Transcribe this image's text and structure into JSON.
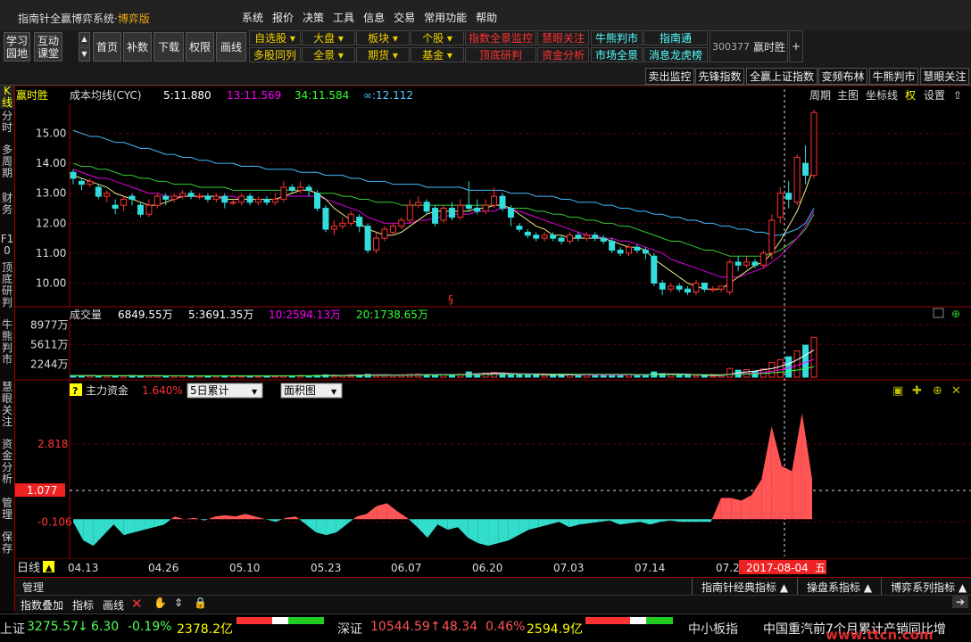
{
  "window": {
    "title": "指南针全赢博弈系统",
    "title_suffix": "博弈版",
    "sep": "·"
  },
  "menu": [
    "系统",
    "报价",
    "决策",
    "工具",
    "信息",
    "交易",
    "常用功能",
    "帮助"
  ],
  "toolbar": {
    "big": [
      "学习园地",
      "互动课堂",
      "首页",
      "补数",
      "下载",
      "权限",
      "画线"
    ],
    "arrows": [
      "▲",
      "▼"
    ],
    "row1": [
      {
        "t": "自选股 ▾",
        "c": "yel"
      },
      {
        "t": "大盘 ▾",
        "c": "yel"
      },
      {
        "t": "板块 ▾",
        "c": "yel"
      },
      {
        "t": "个股 ▾",
        "c": "yel"
      },
      {
        "t": "指数全景监控",
        "c": "red"
      },
      {
        "t": "慧眼关注",
        "c": "red"
      },
      {
        "t": "牛熊判市",
        "c": "cyan"
      },
      {
        "t": "指南通",
        "c": "cyan"
      }
    ],
    "row2": [
      {
        "t": "多股同列",
        "c": "yel"
      },
      {
        "t": "全景 ▾",
        "c": "yel"
      },
      {
        "t": "期货 ▾",
        "c": "yel"
      },
      {
        "t": "基金 ▾",
        "c": "yel"
      },
      {
        "t": "顶底研判",
        "c": "red"
      },
      {
        "t": "资金分析",
        "c": "red"
      },
      {
        "t": "市场全景",
        "c": "cyan"
      },
      {
        "t": "消息龙虎榜",
        "c": "cyan"
      }
    ],
    "stock_code": "300377",
    "stock_name": "赢时胜",
    "plus": "+",
    "tabs": [
      "卖出监控",
      "先锋指数",
      "全赢上证指数",
      "变频布林",
      "牛熊判市",
      "慧眼关注"
    ]
  },
  "leftbar": [
    "K线",
    "分时",
    "多周期",
    "财务",
    "F10",
    "顶底研判",
    "牛熊判市",
    "慧眼关注",
    "资金分析",
    "管理",
    "保存"
  ],
  "chart_header": {
    "name": "赢时胜",
    "indicator": "成本均线(CYC)",
    "ma5": "5:11.880",
    "ma13": "13:11.569",
    "ma34": "34:11.584",
    "mainf": "∞:12.112",
    "right_tools": [
      "周期",
      "主图",
      "坐标线",
      "权",
      "设置",
      "⇧"
    ]
  },
  "chart_data": [
    {
      "type": "candlestick",
      "title": "",
      "yticks": [
        "15.00",
        "14.00",
        "13.00",
        "12.00",
        "11.00",
        "10.00"
      ],
      "ylim": [
        9.3,
        16.0
      ],
      "candles": [
        [
          13.7,
          13.5,
          13.8,
          13.3
        ],
        [
          13.4,
          13.3,
          13.5,
          13.1
        ],
        [
          13.3,
          13.4,
          13.5,
          13.2
        ],
        [
          13.2,
          12.9,
          13.3,
          12.8
        ],
        [
          12.9,
          13.0,
          13.1,
          12.7
        ],
        [
          12.6,
          12.5,
          12.8,
          12.3
        ],
        [
          12.6,
          12.8,
          12.9,
          12.4
        ],
        [
          12.9,
          12.8,
          13.0,
          12.6
        ],
        [
          12.6,
          12.3,
          12.7,
          12.2
        ],
        [
          12.3,
          12.6,
          12.8,
          12.2
        ],
        [
          12.6,
          12.9,
          13.0,
          12.5
        ],
        [
          12.9,
          12.8,
          13.0,
          12.6
        ],
        [
          12.8,
          12.9,
          13.0,
          12.7
        ],
        [
          12.9,
          13.0,
          13.1,
          12.8
        ],
        [
          13.0,
          12.9,
          13.1,
          12.8
        ],
        [
          12.9,
          12.9,
          13.0,
          12.8
        ],
        [
          12.9,
          12.8,
          13.0,
          12.7
        ],
        [
          12.8,
          12.9,
          13.0,
          12.7
        ],
        [
          12.9,
          12.7,
          13.0,
          12.5
        ],
        [
          12.7,
          12.7,
          12.8,
          12.6
        ],
        [
          12.7,
          12.9,
          13.0,
          12.6
        ],
        [
          12.9,
          12.7,
          13.0,
          12.6
        ],
        [
          12.7,
          12.8,
          12.9,
          12.6
        ],
        [
          12.8,
          12.7,
          12.9,
          12.6
        ],
        [
          12.7,
          12.8,
          13.0,
          12.6
        ],
        [
          12.8,
          13.2,
          13.4,
          12.7
        ],
        [
          13.2,
          13.1,
          13.3,
          13.0
        ],
        [
          13.1,
          13.2,
          13.4,
          13.0
        ],
        [
          13.2,
          13.1,
          13.3,
          12.9
        ],
        [
          13.0,
          12.5,
          13.1,
          12.4
        ],
        [
          12.5,
          11.8,
          12.6,
          11.7
        ],
        [
          11.8,
          11.9,
          12.1,
          11.6
        ],
        [
          11.9,
          12.0,
          12.2,
          11.8
        ],
        [
          12.0,
          12.3,
          12.4,
          11.9
        ],
        [
          12.2,
          11.9,
          12.3,
          11.7
        ],
        [
          11.9,
          11.1,
          12.0,
          11.0
        ],
        [
          11.1,
          11.5,
          11.7,
          11.0
        ],
        [
          11.5,
          11.8,
          11.9,
          11.4
        ],
        [
          11.7,
          11.9,
          12.0,
          11.6
        ],
        [
          11.9,
          12.1,
          12.2,
          11.8
        ],
        [
          12.1,
          12.6,
          12.8,
          12.0
        ],
        [
          12.6,
          12.7,
          12.9,
          12.5
        ],
        [
          12.7,
          12.4,
          12.8,
          12.3
        ],
        [
          12.5,
          12.0,
          12.6,
          11.9
        ],
        [
          12.1,
          12.5,
          12.6,
          12.0
        ],
        [
          12.5,
          12.2,
          12.7,
          12.1
        ],
        [
          12.2,
          12.6,
          12.8,
          12.1
        ],
        [
          12.6,
          12.5,
          13.4,
          12.4
        ],
        [
          12.5,
          12.4,
          12.8,
          12.3
        ],
        [
          12.4,
          12.6,
          12.8,
          12.3
        ],
        [
          12.6,
          12.9,
          13.2,
          12.5
        ],
        [
          12.9,
          12.5,
          13.0,
          12.4
        ],
        [
          12.5,
          12.2,
          12.6,
          11.9
        ],
        [
          11.9,
          11.8,
          12.0,
          11.7
        ],
        [
          11.7,
          11.6,
          11.8,
          11.5
        ],
        [
          11.6,
          11.5,
          11.7,
          11.4
        ],
        [
          11.5,
          11.6,
          11.7,
          11.4
        ],
        [
          11.6,
          11.5,
          11.7,
          11.4
        ],
        [
          11.5,
          11.4,
          11.6,
          11.3
        ],
        [
          11.4,
          11.6,
          11.7,
          11.3
        ],
        [
          11.6,
          11.5,
          11.7,
          11.4
        ],
        [
          11.5,
          11.6,
          11.7,
          11.4
        ],
        [
          11.6,
          11.5,
          11.7,
          11.4
        ],
        [
          11.5,
          11.4,
          11.6,
          11.3
        ],
        [
          11.4,
          11.1,
          11.5,
          11.0
        ],
        [
          11.1,
          11.0,
          11.2,
          10.9
        ],
        [
          11.0,
          11.2,
          11.3,
          10.9
        ],
        [
          11.2,
          11.1,
          11.3,
          11.0
        ],
        [
          11.1,
          11.0,
          11.2,
          10.8
        ],
        [
          10.9,
          10.0,
          11.0,
          9.9
        ],
        [
          10.0,
          9.8,
          10.1,
          9.6
        ],
        [
          9.8,
          9.9,
          10.0,
          9.7
        ],
        [
          9.9,
          9.8,
          10.0,
          9.7
        ],
        [
          9.8,
          9.7,
          9.9,
          9.6
        ],
        [
          9.7,
          10.0,
          10.1,
          9.6
        ],
        [
          10.0,
          9.8,
          10.0,
          9.7
        ],
        [
          9.8,
          9.8,
          9.9,
          9.7
        ],
        [
          9.8,
          9.9,
          9.9,
          9.7
        ],
        [
          9.7,
          10.7,
          10.8,
          9.6
        ],
        [
          10.7,
          10.6,
          10.9,
          10.4
        ],
        [
          10.6,
          10.7,
          10.9,
          10.5
        ],
        [
          10.7,
          10.6,
          10.8,
          10.5
        ],
        [
          10.6,
          11.0,
          11.1,
          10.5
        ],
        [
          11.0,
          12.1,
          12.3,
          10.8
        ],
        [
          12.2,
          13.0,
          13.2,
          12.0
        ],
        [
          13.0,
          12.8,
          13.4,
          12.5
        ],
        [
          12.7,
          14.2,
          14.3,
          12.6
        ],
        [
          14.0,
          13.6,
          14.6,
          13.3
        ],
        [
          13.6,
          15.7,
          15.8,
          13.5
        ]
      ],
      "ma5": [
        13.6,
        13.5,
        13.4,
        13.3,
        13.2,
        13.0,
        12.9,
        12.8,
        12.7,
        12.6,
        12.6,
        12.7,
        12.8,
        12.9,
        12.9,
        12.9,
        12.9,
        12.9,
        12.8,
        12.8,
        12.8,
        12.8,
        12.8,
        12.8,
        12.8,
        12.9,
        13.0,
        13.1,
        13.1,
        13.0,
        12.8,
        12.5,
        12.3,
        12.1,
        12.0,
        11.8,
        11.7,
        11.6,
        11.6,
        11.7,
        11.9,
        12.1,
        12.3,
        12.4,
        12.4,
        12.4,
        12.4,
        12.4,
        12.5,
        12.5,
        12.6,
        12.6,
        12.5,
        12.3,
        12.1,
        11.9,
        11.8,
        11.6,
        11.6,
        11.5,
        11.5,
        11.5,
        11.5,
        11.5,
        11.4,
        11.3,
        11.2,
        11.2,
        11.1,
        10.8,
        10.6,
        10.4,
        10.2,
        10.0,
        9.9,
        9.8,
        9.8,
        9.8,
        10.0,
        10.2,
        10.4,
        10.6,
        10.7,
        11.0,
        11.4,
        11.9,
        12.4,
        13.1,
        13.9
      ],
      "ma13": [
        13.8,
        13.7,
        13.6,
        13.5,
        13.5,
        13.4,
        13.3,
        13.2,
        13.1,
        13.0,
        13.0,
        12.9,
        12.9,
        12.9,
        12.9,
        12.9,
        12.9,
        12.9,
        12.9,
        12.9,
        12.8,
        12.8,
        12.8,
        12.8,
        12.8,
        12.9,
        12.9,
        12.9,
        12.9,
        12.9,
        12.8,
        12.7,
        12.6,
        12.5,
        12.4,
        12.2,
        12.1,
        12.0,
        12.0,
        12.0,
        12.0,
        12.1,
        12.1,
        12.2,
        12.2,
        12.3,
        12.3,
        12.3,
        12.4,
        12.4,
        12.4,
        12.5,
        12.5,
        12.4,
        12.3,
        12.2,
        12.1,
        12.0,
        11.9,
        11.8,
        11.7,
        11.6,
        11.6,
        11.5,
        11.5,
        11.4,
        11.4,
        11.3,
        11.2,
        11.1,
        11.0,
        10.8,
        10.7,
        10.6,
        10.5,
        10.4,
        10.3,
        10.2,
        10.2,
        10.2,
        10.3,
        10.4,
        10.5,
        10.7,
        10.9,
        11.2,
        11.5,
        11.9,
        12.4
      ],
      "ma34": [
        14.0,
        13.9,
        13.9,
        13.8,
        13.8,
        13.7,
        13.6,
        13.6,
        13.5,
        13.5,
        13.4,
        13.4,
        13.3,
        13.3,
        13.3,
        13.2,
        13.2,
        13.2,
        13.2,
        13.1,
        13.1,
        13.1,
        13.1,
        13.1,
        13.1,
        13.1,
        13.1,
        13.1,
        13.1,
        13.0,
        13.0,
        13.0,
        12.9,
        12.9,
        12.8,
        12.8,
        12.7,
        12.7,
        12.7,
        12.6,
        12.6,
        12.6,
        12.6,
        12.6,
        12.6,
        12.6,
        12.6,
        12.6,
        12.6,
        12.6,
        12.6,
        12.6,
        12.5,
        12.5,
        12.5,
        12.4,
        12.4,
        12.3,
        12.3,
        12.2,
        12.2,
        12.1,
        12.1,
        12.0,
        12.0,
        11.9,
        11.9,
        11.8,
        11.7,
        11.6,
        11.5,
        11.4,
        11.4,
        11.3,
        11.2,
        11.1,
        11.1,
        11.0,
        10.9,
        10.9,
        10.9,
        10.9,
        10.9,
        11.0,
        11.1,
        11.3,
        11.5,
        11.8,
        12.3
      ],
      "ma_inf": [
        15.1,
        15.0,
        14.9,
        14.9,
        14.8,
        14.7,
        14.7,
        14.6,
        14.5,
        14.5,
        14.4,
        14.3,
        14.3,
        14.2,
        14.2,
        14.1,
        14.1,
        14.0,
        14.0,
        14.0,
        13.9,
        13.9,
        13.9,
        13.8,
        13.8,
        13.8,
        13.8,
        13.7,
        13.7,
        13.7,
        13.6,
        13.6,
        13.6,
        13.5,
        13.5,
        13.4,
        13.4,
        13.4,
        13.3,
        13.3,
        13.3,
        13.3,
        13.2,
        13.2,
        13.2,
        13.2,
        13.2,
        13.1,
        13.1,
        13.1,
        13.1,
        13.1,
        13.0,
        13.0,
        13.0,
        12.9,
        12.9,
        12.9,
        12.8,
        12.8,
        12.7,
        12.7,
        12.7,
        12.6,
        12.6,
        12.5,
        12.5,
        12.4,
        12.4,
        12.3,
        12.3,
        12.2,
        12.2,
        12.1,
        12.1,
        12.0,
        12.0,
        11.9,
        11.9,
        11.8,
        11.8,
        11.7,
        11.7,
        11.6,
        11.6,
        11.7,
        11.8,
        12.0,
        12.5
      ],
      "marker": "§"
    },
    {
      "type": "bar",
      "title": "成交量",
      "label_total": "6849.55万",
      "ma5": "5:3691.35万",
      "ma10": "10:2594.13万",
      "ma20": "20:1738.65万",
      "yticks": [
        "8977万",
        "5611万",
        "2244万"
      ],
      "values": [
        300,
        250,
        280,
        200,
        260,
        220,
        240,
        280,
        210,
        230,
        260,
        200,
        220,
        240,
        210,
        230,
        200,
        220,
        250,
        190,
        210,
        230,
        200,
        220,
        210,
        260,
        240,
        280,
        230,
        300,
        400,
        350,
        300,
        420,
        380,
        500,
        420,
        380,
        350,
        400,
        480,
        520,
        450,
        400,
        460,
        420,
        500,
        900,
        600,
        700,
        800,
        650,
        500,
        450,
        400,
        380,
        350,
        420,
        380,
        400,
        350,
        380,
        360,
        400,
        450,
        420,
        380,
        400,
        450,
        900,
        600,
        450,
        380,
        350,
        300,
        280,
        260,
        300,
        1500,
        1200,
        1300,
        1000,
        1400,
        2500,
        3000,
        3500,
        4500,
        5500,
        6849.55
      ]
    },
    {
      "type": "area",
      "title": "主力资金",
      "pct": "1.640%",
      "select1": "5日累计",
      "select2": "面积图",
      "yticks": [
        "2.818",
        "1.077",
        "-0.106"
      ],
      "current": "1.077",
      "values": [
        -0.1,
        -0.8,
        -1.0,
        -0.6,
        -0.2,
        -0.6,
        -0.5,
        -0.4,
        -0.3,
        -0.2,
        0.1,
        0.0,
        0.05,
        -0.05,
        0.1,
        0.15,
        0.1,
        0.2,
        0.1,
        0.0,
        -0.1,
        0.05,
        0.1,
        -0.2,
        -0.5,
        -0.6,
        -0.5,
        -0.2,
        0.1,
        0.2,
        0.5,
        0.6,
        0.3,
        0.05,
        -0.3,
        -0.7,
        -0.2,
        -0.4,
        -0.3,
        -0.7,
        -0.9,
        -1.0,
        -0.9,
        -0.8,
        -0.6,
        -0.4,
        -0.3,
        -0.2,
        -0.1,
        -0.3,
        -0.2,
        -0.15,
        -0.1,
        -0.05,
        -0.2,
        -0.15,
        -0.1,
        -0.2,
        -0.1,
        -0.05,
        -0.1,
        -0.1,
        -0.1,
        -0.1,
        0.8,
        0.8,
        0.7,
        0.9,
        1.5,
        3.5,
        2.0,
        1.8,
        4.0,
        1.5
      ]
    },
    {
      "x_labels": [
        "04.13",
        "04.26",
        "05.10",
        "05.23",
        "06.07",
        "06.20",
        "07.03",
        "07.14",
        "07.2",
        "2017-08-04",
        "五"
      ],
      "period": "日线"
    }
  ],
  "panel": {
    "manage": "管理",
    "indicator_tools": [
      "指数叠加",
      "指标",
      "画线"
    ],
    "right_tabs": [
      "指南针经典指标 ▲",
      "操盘系指标 ▲",
      "博弈系列指标 ▲"
    ],
    "arrow": "➔"
  },
  "status": {
    "sh_name": "上证",
    "sh_val": "3275.57",
    "sh_arrow": "↓",
    "sh_chg": "6.30",
    "sh_pct": "-0.19%",
    "sh_amt": "2378.2亿",
    "sz_name": "深证",
    "sz_val": "10544.59",
    "sz_arrow": "↑",
    "sz_chg": "48.34",
    "sz_pct": "0.46%",
    "sz_amt": "2594.9亿",
    "sme": "中小板指",
    "news": "中国重汽前7个月累计产销同比增",
    "watermark": "www.ttcn.com"
  }
}
